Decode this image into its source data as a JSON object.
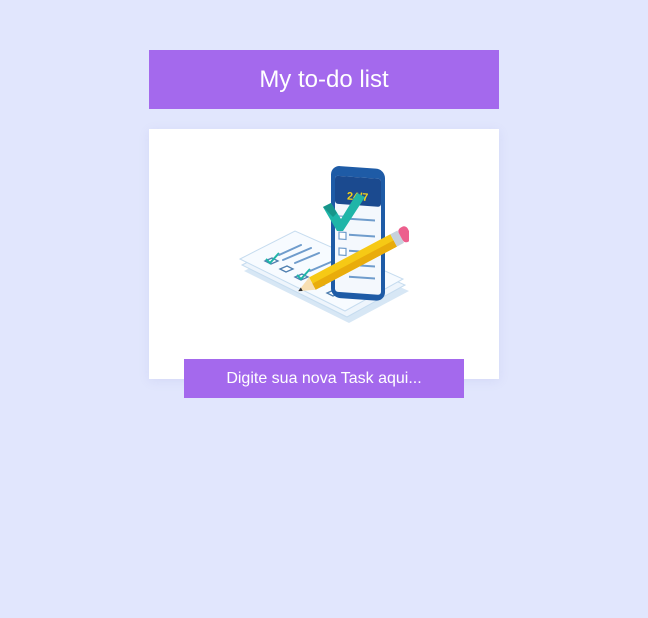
{
  "header": {
    "title": "My to-do list"
  },
  "illustration": {
    "icon": "todo-checklist-phone-illustration",
    "phone_label": "24/7"
  },
  "task_input": {
    "placeholder": "Digite sua nova Task aqui...",
    "value": ""
  },
  "colors": {
    "background": "#e1e6fd",
    "accent": "#a469ed",
    "card": "#ffffff"
  }
}
